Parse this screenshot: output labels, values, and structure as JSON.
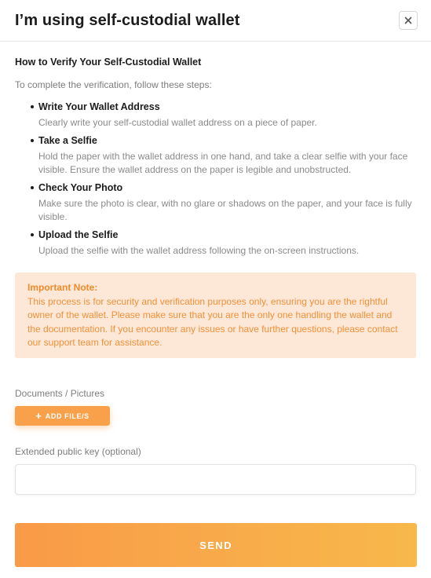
{
  "header": {
    "title": "I’m using self-custodial wallet"
  },
  "content": {
    "section_title": "How to Verify Your Self-Custodial Wallet",
    "intro": "To complete the verification, follow these steps:",
    "steps": [
      {
        "title": "Write Your Wallet Address",
        "description": "Clearly write your self-custodial wallet address on a piece of paper."
      },
      {
        "title": "Take a Selfie",
        "description": "Hold the paper with the wallet address in one hand, and take a clear selfie with your face visible. Ensure the wallet address on the paper is legible and unobstructed."
      },
      {
        "title": "Check Your Photo",
        "description": "Make sure the photo is clear, with no glare or shadows on the paper, and your face is fully visible."
      },
      {
        "title": "Upload the Selfie",
        "description": "Upload the selfie with the wallet address following the on-screen instructions."
      }
    ],
    "note": {
      "title": "Important Note:",
      "text": "This process is for security and verification purposes only, ensuring you are the rightful owner of the wallet. Please make sure that you are the only one handling the wallet and the documentation. If you encounter any issues or have further questions, please contact our support team for assistance."
    }
  },
  "form": {
    "documents_label": "Documents / Pictures",
    "add_files_label": "ADD FILE/S",
    "xpub_label": "Extended public key (optional)",
    "xpub_value": "",
    "xpub_placeholder": "",
    "send_label": "SEND"
  },
  "icons": {
    "close": "close-icon",
    "add": "plus-icon"
  },
  "colors": {
    "accent": "#f9a04a",
    "note_background": "#fde8d7",
    "note_text": "#f0903a"
  }
}
